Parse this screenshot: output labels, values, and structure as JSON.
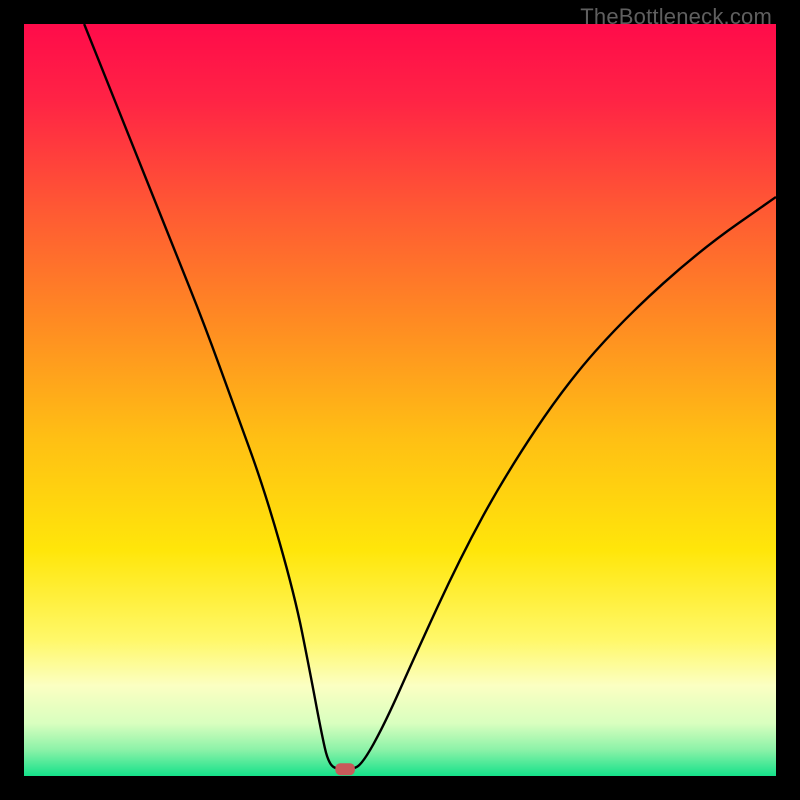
{
  "watermark": "TheBottleneck.com",
  "chart_data": {
    "type": "line",
    "title": "",
    "xlabel": "",
    "ylabel": "",
    "xlim": [
      0,
      100
    ],
    "ylim": [
      0,
      100
    ],
    "grid": false,
    "legend": false,
    "background": {
      "type": "vertical-gradient",
      "stops": [
        {
          "pos": 0.0,
          "color": "#ff0b4a"
        },
        {
          "pos": 0.1,
          "color": "#ff2345"
        },
        {
          "pos": 0.25,
          "color": "#ff5a33"
        },
        {
          "pos": 0.4,
          "color": "#ff8c22"
        },
        {
          "pos": 0.55,
          "color": "#ffbf14"
        },
        {
          "pos": 0.7,
          "color": "#ffe60a"
        },
        {
          "pos": 0.82,
          "color": "#fff86a"
        },
        {
          "pos": 0.88,
          "color": "#fbffc2"
        },
        {
          "pos": 0.93,
          "color": "#d9ffbf"
        },
        {
          "pos": 0.965,
          "color": "#8cf2a8"
        },
        {
          "pos": 1.0,
          "color": "#15e18a"
        }
      ]
    },
    "series": [
      {
        "name": "bottleneck-curve",
        "stroke": "#000000",
        "stroke_width": 2.4,
        "x": [
          8,
          12,
          16,
          20,
          24,
          28,
          32,
          36,
          38,
          39.5,
          40.5,
          42,
          43.5,
          45,
          48,
          52,
          58,
          64,
          72,
          80,
          90,
          100
        ],
        "y": [
          100,
          90,
          80,
          70,
          60,
          49,
          38,
          24,
          14,
          6,
          1.5,
          0.8,
          0.8,
          1.6,
          7,
          16,
          29,
          40,
          52,
          61,
          70,
          77
        ]
      }
    ],
    "markers": [
      {
        "name": "min-point",
        "shape": "rounded-rect",
        "cx": 42.7,
        "cy": 0.9,
        "w": 2.6,
        "h": 1.6,
        "fill": "#c85a5a"
      }
    ]
  }
}
